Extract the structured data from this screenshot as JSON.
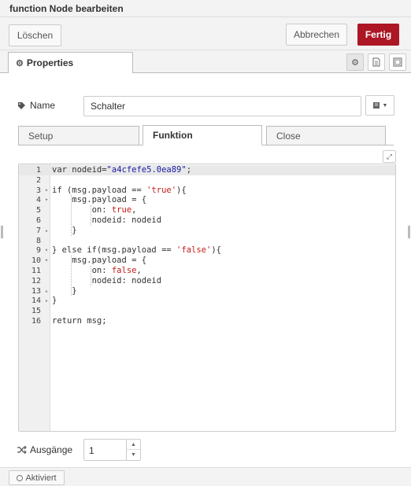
{
  "dialog": {
    "title": "function Node bearbeiten",
    "delete_label": "Löschen",
    "cancel_label": "Abbrechen",
    "done_label": "Fertig",
    "accent_color": "#ad1625"
  },
  "tabs": {
    "properties_label": "Properties",
    "icons": [
      "gear-icon",
      "description-icon",
      "appearance-icon"
    ]
  },
  "form": {
    "name_label": "Name",
    "name_value": "Schalter",
    "subtabs": [
      "Setup",
      "Funktion",
      "Close"
    ],
    "active_subtab": "Funktion",
    "outputs_label": "Ausgänge",
    "outputs_value": "1"
  },
  "editor": {
    "lines": [
      {
        "n": "1",
        "fold": ""
      },
      {
        "n": "2",
        "fold": ""
      },
      {
        "n": "3",
        "fold": "▾"
      },
      {
        "n": "4",
        "fold": "▾"
      },
      {
        "n": "5",
        "fold": ""
      },
      {
        "n": "6",
        "fold": ""
      },
      {
        "n": "7",
        "fold": "▴"
      },
      {
        "n": "8",
        "fold": ""
      },
      {
        "n": "9",
        "fold": "▾"
      },
      {
        "n": "10",
        "fold": "▾"
      },
      {
        "n": "11",
        "fold": ""
      },
      {
        "n": "12",
        "fold": ""
      },
      {
        "n": "13",
        "fold": "▴"
      },
      {
        "n": "14",
        "fold": "▴"
      },
      {
        "n": "15",
        "fold": ""
      },
      {
        "n": "16",
        "fold": ""
      }
    ],
    "code": [
      "var nodeid=\"a4cfefe5.0ea89\";",
      "",
      "if (msg.payload == 'true'){",
      "    msg.payload = {",
      "        on: true,",
      "        nodeid: nodeid",
      "    }",
      "",
      "} else if(msg.payload == 'false'){",
      "    msg.payload = {",
      "        on: false,",
      "        nodeid: nodeid",
      "    }",
      "}",
      "",
      "return msg;"
    ]
  },
  "footer": {
    "enabled_label": "Aktiviert"
  }
}
